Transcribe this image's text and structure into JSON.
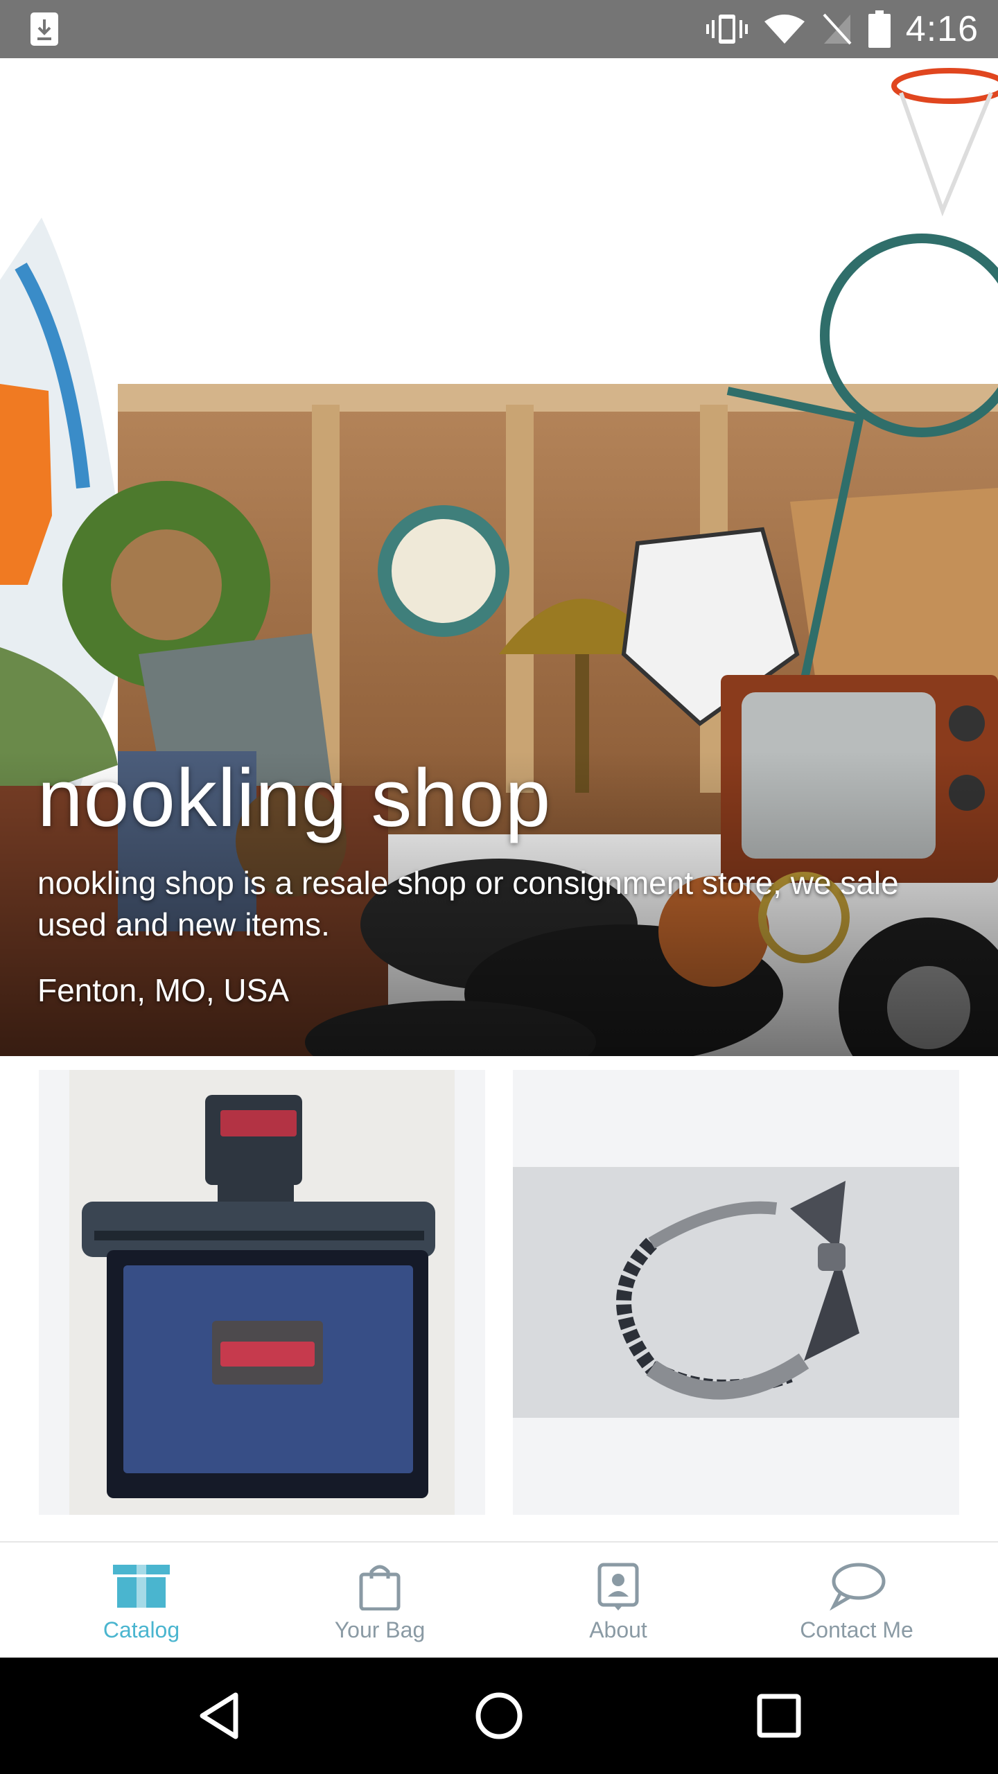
{
  "status_bar": {
    "time": "4:16",
    "icons": [
      "download-icon",
      "vibrate-icon",
      "wifi-icon",
      "no-sim-icon",
      "battery-icon"
    ]
  },
  "hero": {
    "title": "nookling shop",
    "description": "nookling shop is a resale shop or consignment store, we sale used and new items.",
    "location": "Fenton, MO, USA"
  },
  "catalog": {
    "items": [
      {
        "image": "dickies-wallet-photo"
      },
      {
        "image": "gray-bow-headband-photo"
      }
    ]
  },
  "bottom_nav": {
    "items": [
      {
        "label": "Catalog",
        "icon": "box-icon",
        "active": true
      },
      {
        "label": "Your Bag",
        "icon": "bag-icon",
        "active": false
      },
      {
        "label": "About",
        "icon": "person-card-icon",
        "active": false
      },
      {
        "label": "Contact Me",
        "icon": "speech-bubble-icon",
        "active": false
      }
    ]
  },
  "colors": {
    "accent": "#4ab5cf",
    "inactive": "#8a9aa4",
    "status_bar": "#757575"
  }
}
